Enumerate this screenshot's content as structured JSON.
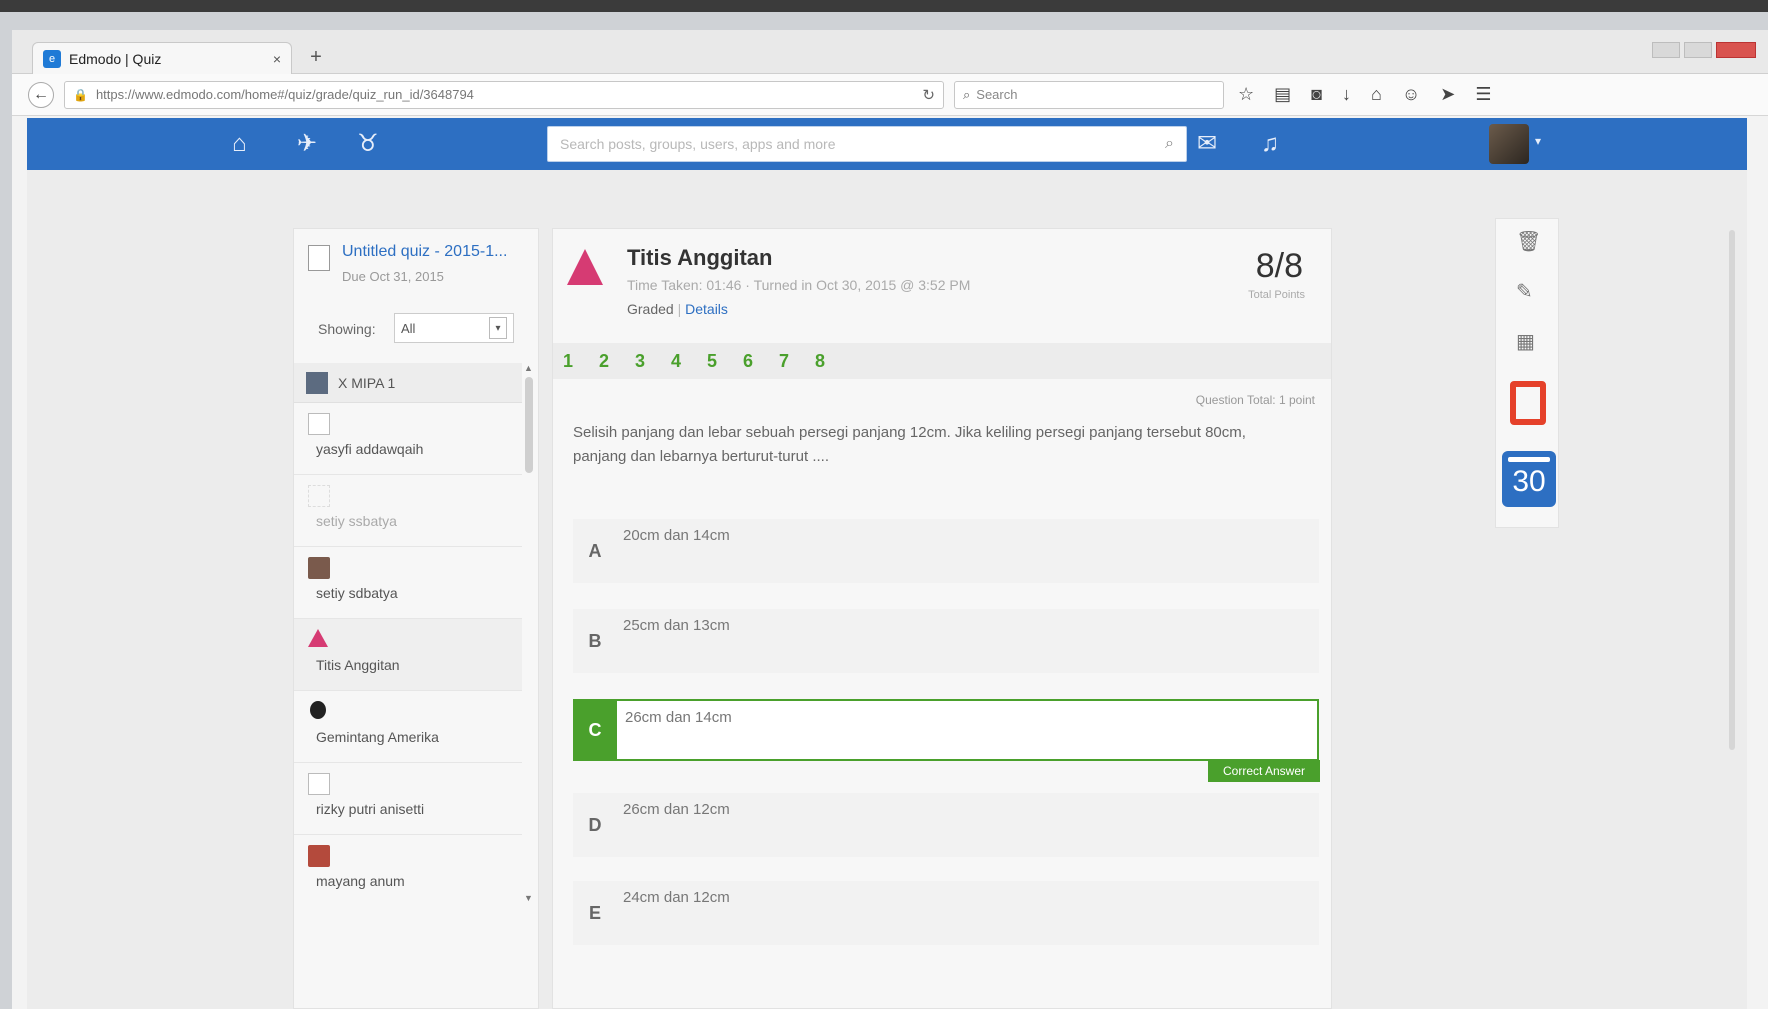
{
  "browser": {
    "tab_title": "Edmodo | Quiz",
    "url": "https://www.edmodo.com/home#/quiz/grade/quiz_run_id/3648794",
    "search_placeholder": "Search"
  },
  "header": {
    "search_placeholder": "Search posts, groups, users, apps and more"
  },
  "quiz": {
    "title": "Untitled quiz - 2015-1...",
    "due": "Due Oct 31, 2015",
    "showing_label": "Showing:",
    "showing_value": "All"
  },
  "students": {
    "group": "X MIPA 1",
    "items": [
      {
        "name": "yasyfi addawqaih"
      },
      {
        "name": "setiy ssbatya"
      },
      {
        "name": "setiy sdbatya"
      },
      {
        "name": "Titis Anggitan"
      },
      {
        "name": "Gemintang Amerika"
      },
      {
        "name": "rizky putri anisetti"
      },
      {
        "name": "mayang anum"
      }
    ]
  },
  "submission": {
    "student_name": "Titis Anggitan",
    "meta": "Time Taken: 01:46  ·  Turned in Oct 30, 2015 @ 3:52 PM",
    "status": "Graded",
    "status_link": "Details",
    "score": "8/8",
    "score_label": "Total Points"
  },
  "question": {
    "numbers": [
      "1",
      "2",
      "3",
      "4",
      "5",
      "6",
      "7",
      "8"
    ],
    "meta": "Question Total: 1 point",
    "text": "Selisih panjang dan lebar sebuah persegi panjang 12cm. Jika keliling persegi panjang tersebut 80cm, panjang dan lebarnya berturut-turut ....",
    "answers": [
      {
        "letter": "A",
        "text": "20cm dan 14cm"
      },
      {
        "letter": "B",
        "text": "25cm dan 13cm"
      },
      {
        "letter": "C",
        "text": "26cm dan 14cm"
      },
      {
        "letter": "D",
        "text": "26cm dan 12cm"
      },
      {
        "letter": "E",
        "text": "24cm dan 12cm"
      }
    ],
    "correct_label": "Correct Answer"
  },
  "sidebar": {
    "calendar_day": "30"
  },
  "colors": {
    "brand_blue": "#2d6fc2",
    "correct_green": "#4aa02c",
    "office_red": "#e5412a",
    "avatar_pink": "#d63b73"
  }
}
